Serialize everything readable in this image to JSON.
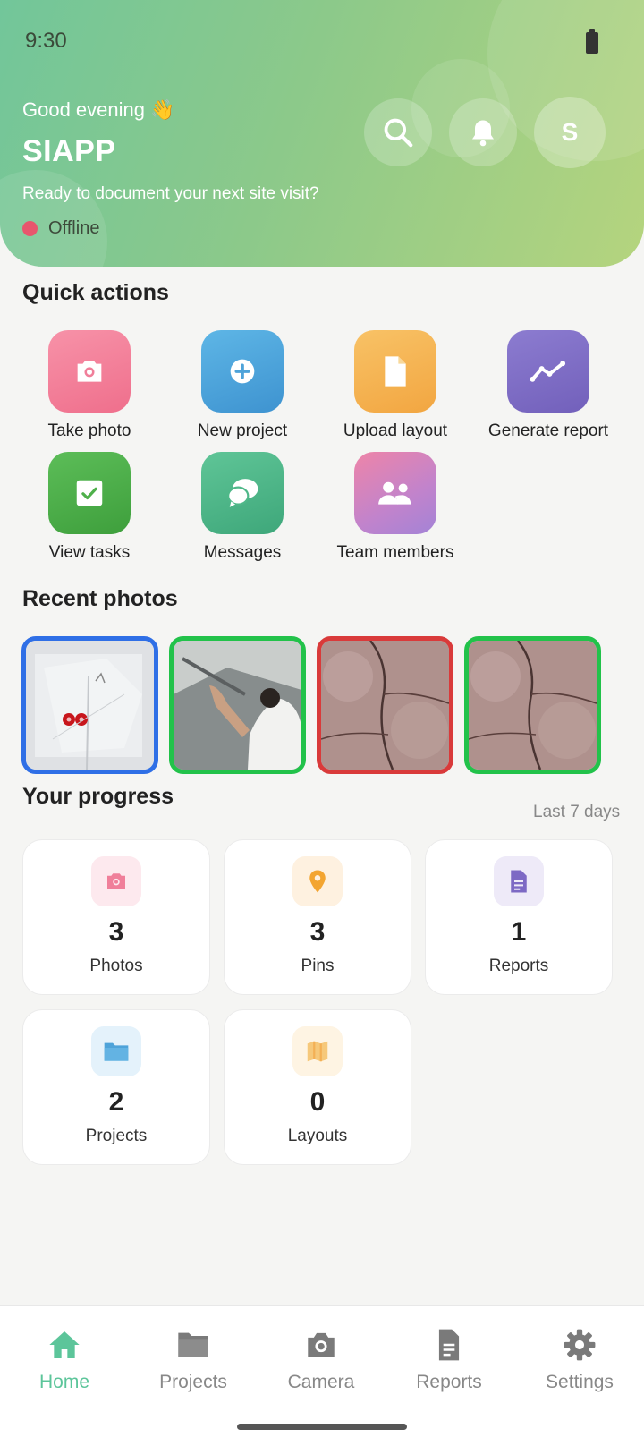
{
  "status_bar": {
    "time": "9:30"
  },
  "header": {
    "greeting": "Good evening 👋",
    "app_name": "SIAPP",
    "subtitle": "Ready to document your next site visit?",
    "connection_status": "Offline",
    "avatar_initial": "S"
  },
  "quick_actions": {
    "title": "Quick actions",
    "items": [
      {
        "label": "Take photo",
        "icon": "camera-icon",
        "color": "#f07f9a"
      },
      {
        "label": "New project",
        "icon": "plus-circle-icon",
        "color": "#4ea3d9"
      },
      {
        "label": "Upload layout",
        "icon": "document-icon",
        "color": "#f5b24f"
      },
      {
        "label": "Generate report",
        "icon": "trend-line-icon",
        "color": "#7d69c4"
      },
      {
        "label": "View tasks",
        "icon": "checkbox-icon",
        "color": "#4fb04b"
      },
      {
        "label": "Messages",
        "icon": "chat-bubbles-icon",
        "color": "#4fb889"
      },
      {
        "label": "Team members",
        "icon": "people-icon",
        "color": "#d47fb8"
      }
    ]
  },
  "recent_photos": {
    "title": "Recent photos",
    "items": [
      {
        "border_color": "#2f6fe6"
      },
      {
        "border_color": "#22c24a"
      },
      {
        "border_color": "#d93a3a"
      },
      {
        "border_color": "#22c24a"
      }
    ]
  },
  "progress": {
    "title": "Your progress",
    "period": "Last 7 days",
    "stats": [
      {
        "value": "3",
        "label": "Photos",
        "icon": "camera-icon",
        "color": "#f07f9a"
      },
      {
        "value": "3",
        "label": "Pins",
        "icon": "pin-icon",
        "color": "#f3a531"
      },
      {
        "value": "1",
        "label": "Reports",
        "icon": "document-icon",
        "color": "#7d69c4"
      },
      {
        "value": "2",
        "label": "Projects",
        "icon": "folder-icon",
        "color": "#4ea3d9"
      },
      {
        "value": "0",
        "label": "Layouts",
        "icon": "map-icon",
        "color": "#f3b055"
      }
    ]
  },
  "bottom_nav": {
    "items": [
      {
        "label": "Home",
        "icon": "home-icon",
        "active": true
      },
      {
        "label": "Projects",
        "icon": "folder-icon",
        "active": false
      },
      {
        "label": "Camera",
        "icon": "camera-icon",
        "active": false
      },
      {
        "label": "Reports",
        "icon": "document-icon",
        "active": false
      },
      {
        "label": "Settings",
        "icon": "gear-icon",
        "active": false
      }
    ]
  },
  "colors": {
    "accent": "#5cc59a",
    "background": "#f5f5f3"
  }
}
